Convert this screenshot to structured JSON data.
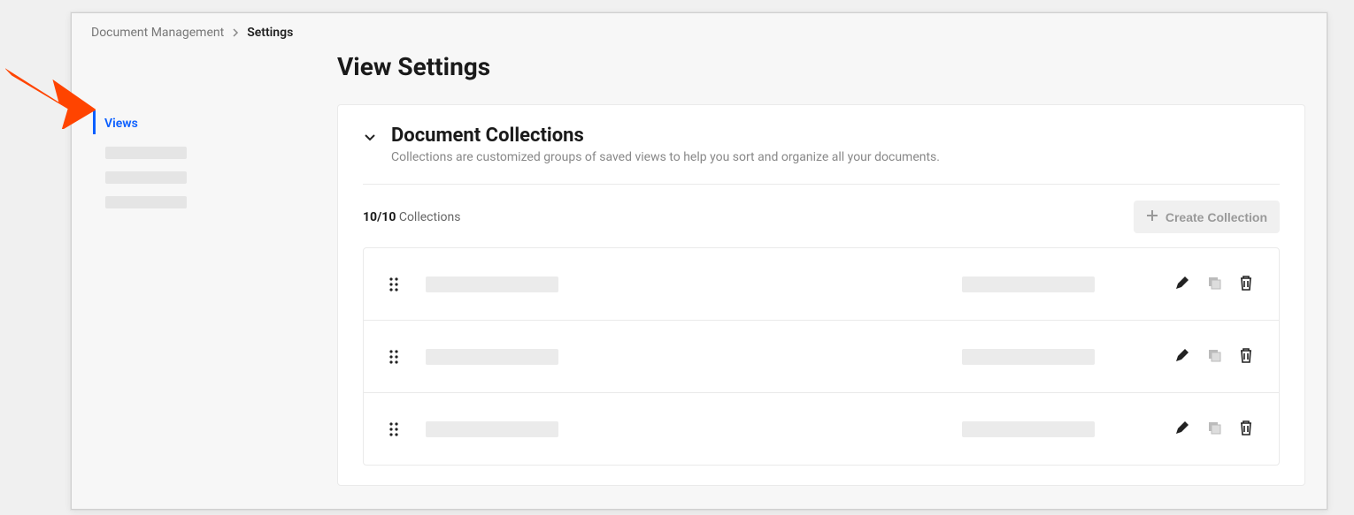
{
  "breadcrumb": {
    "root": "Document Management",
    "current": "Settings"
  },
  "sidebar": {
    "items": [
      {
        "label": "Views",
        "active": true
      }
    ]
  },
  "page": {
    "title": "View Settings"
  },
  "panel": {
    "title": "Document Collections",
    "subtitle": "Collections are customized groups of saved views to help you sort and organize all your documents.",
    "count_current": "10",
    "count_max": "10",
    "count_label": " Collections",
    "create_button": "Create Collection"
  }
}
